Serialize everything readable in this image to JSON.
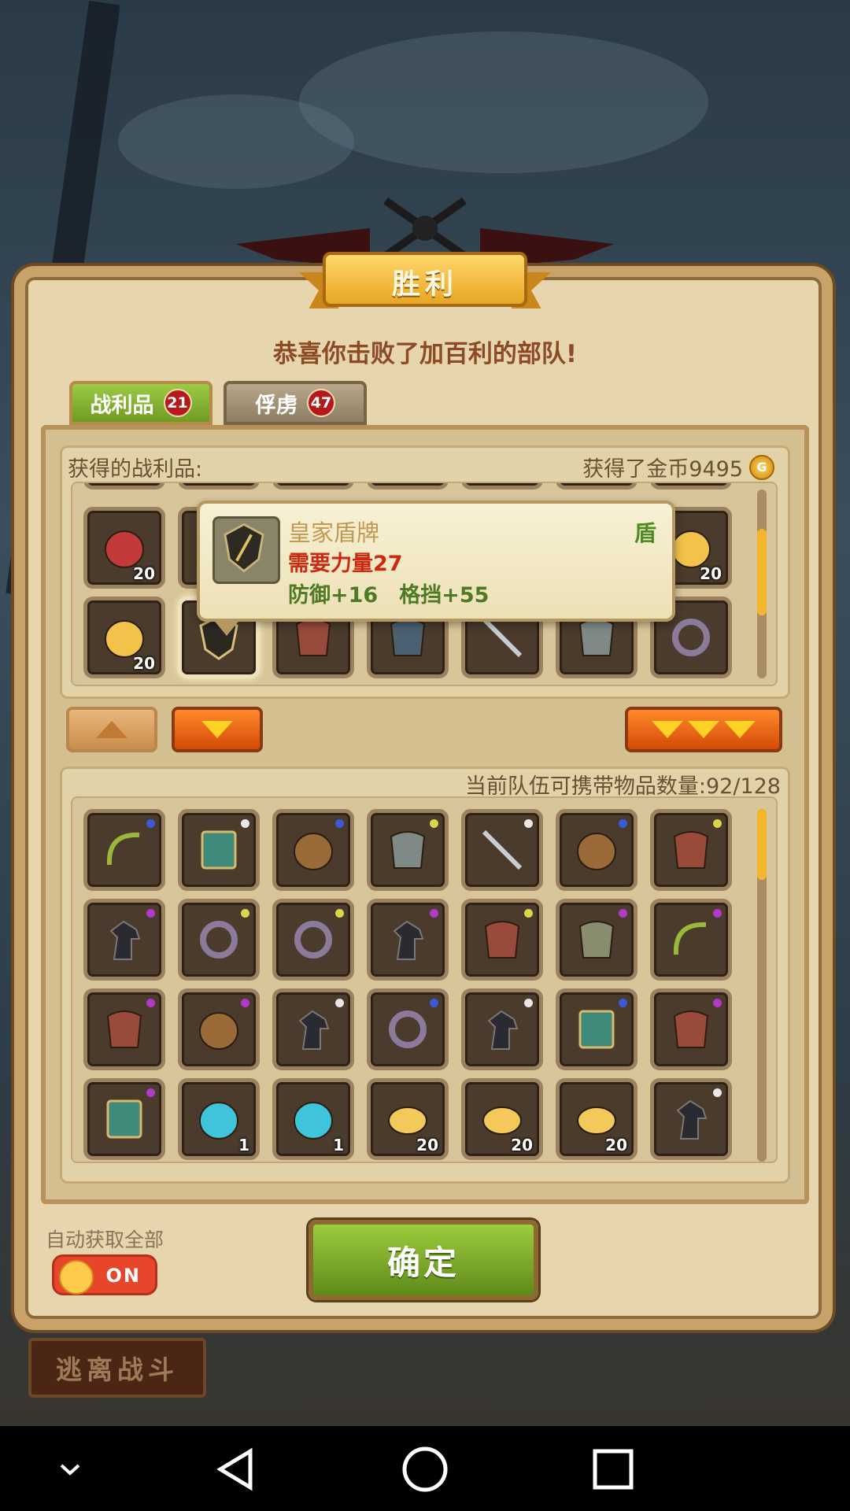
{
  "header": {
    "title": "胜利",
    "subtitle": "恭喜你击败了加百利的部队!"
  },
  "tabs": [
    {
      "label": "战利品",
      "badge": "21",
      "active": true
    },
    {
      "label": "俘虏",
      "badge": "47",
      "active": false
    }
  ],
  "loot": {
    "label": "获得的战利品:",
    "gold_text": "获得了金币9495",
    "coin_glyph": "G"
  },
  "tooltip": {
    "name": "皇家盾牌",
    "type": "盾",
    "requirement": "需要力量27",
    "stats": "防御+16　格挡+55"
  },
  "loot_rows": [
    [
      {
        "icon": "meat-icon",
        "count": "20"
      },
      {
        "icon": "item-icon",
        "count": ""
      },
      {
        "icon": "item-icon",
        "count": ""
      },
      {
        "icon": "item-icon",
        "count": ""
      },
      {
        "icon": "item-icon",
        "count": ""
      },
      {
        "icon": "item-icon",
        "count": ""
      },
      {
        "icon": "cheese-icon",
        "count": "20"
      }
    ],
    [
      {
        "icon": "cheese-icon",
        "count": "20"
      },
      {
        "icon": "shield-icon",
        "count": "",
        "selected": true
      },
      {
        "icon": "armor-icon",
        "count": ""
      },
      {
        "icon": "hood-icon",
        "count": ""
      },
      {
        "icon": "sword-icon",
        "count": ""
      },
      {
        "icon": "helmet-icon",
        "count": ""
      },
      {
        "icon": "ring-icon",
        "count": ""
      }
    ]
  ],
  "inventory": {
    "capacity_text": "当前队伍可携带物品数量:92/128",
    "rows": [
      [
        {
          "icon": "bow-icon",
          "rarity": "blue",
          "count": ""
        },
        {
          "icon": "book-icon",
          "rarity": "white",
          "count": ""
        },
        {
          "icon": "round-shield-icon",
          "rarity": "blue",
          "count": ""
        },
        {
          "icon": "helmet-icon",
          "rarity": "yellow",
          "count": ""
        },
        {
          "icon": "sword-icon",
          "rarity": "white",
          "count": ""
        },
        {
          "icon": "round-shield-icon",
          "rarity": "blue",
          "count": ""
        },
        {
          "icon": "armor-icon",
          "rarity": "yellow",
          "count": ""
        }
      ],
      [
        {
          "icon": "horse-icon",
          "rarity": "purple",
          "count": ""
        },
        {
          "icon": "ring-icon",
          "rarity": "yellow",
          "count": ""
        },
        {
          "icon": "ring-icon",
          "rarity": "yellow",
          "count": ""
        },
        {
          "icon": "horse-icon",
          "rarity": "purple",
          "count": ""
        },
        {
          "icon": "armor-icon",
          "rarity": "yellow",
          "count": ""
        },
        {
          "icon": "axe-icon",
          "rarity": "purple",
          "count": ""
        },
        {
          "icon": "bow-icon",
          "rarity": "purple",
          "count": ""
        }
      ],
      [
        {
          "icon": "armor-icon",
          "rarity": "purple",
          "count": ""
        },
        {
          "icon": "round-shield-icon",
          "rarity": "purple",
          "count": ""
        },
        {
          "icon": "horse-icon",
          "rarity": "white",
          "count": ""
        },
        {
          "icon": "ring-icon",
          "rarity": "blue",
          "count": ""
        },
        {
          "icon": "horse-icon",
          "rarity": "white",
          "count": ""
        },
        {
          "icon": "book-icon",
          "rarity": "blue",
          "count": ""
        },
        {
          "icon": "armor-icon",
          "rarity": "purple",
          "count": ""
        }
      ],
      [
        {
          "icon": "book-icon",
          "rarity": "purple",
          "count": ""
        },
        {
          "icon": "potion-icon",
          "rarity": "",
          "count": "1"
        },
        {
          "icon": "potion-icon",
          "rarity": "",
          "count": "1"
        },
        {
          "icon": "bread-icon",
          "rarity": "",
          "count": "20"
        },
        {
          "icon": "bread-icon",
          "rarity": "",
          "count": "20"
        },
        {
          "icon": "bread-icon",
          "rarity": "",
          "count": "20"
        },
        {
          "icon": "horse-icon",
          "rarity": "white",
          "count": ""
        }
      ]
    ]
  },
  "footer": {
    "auto_label": "自动获取全部",
    "toggle_text": "ON",
    "confirm_label": "确定",
    "escape_label": "逃离战斗"
  },
  "colors": {
    "blue": "#3a5ad8",
    "white": "#e8e8e8",
    "yellow": "#d8d64a",
    "purple": "#b13ac8",
    "icon": {
      "meat-icon": "#c23a3a",
      "cheese-icon": "#f3c24a",
      "bread-icon": "#f2c95a",
      "shield-icon": "#6e6a4a",
      "round-shield-icon": "#9a6a38",
      "armor-icon": "#9a4a3a",
      "hood-icon": "#4b6070",
      "sword-icon": "#c8ccd0",
      "helmet-icon": "#7f8a86",
      "ring-icon": "#8c7a9a",
      "bow-icon": "#9bb83a",
      "book-icon": "#3f8a7a",
      "horse-icon": "#2a2a30",
      "axe-icon": "#8a8c70",
      "potion-icon": "#3fc4dc",
      "item-icon": "#6a5a48"
    }
  }
}
